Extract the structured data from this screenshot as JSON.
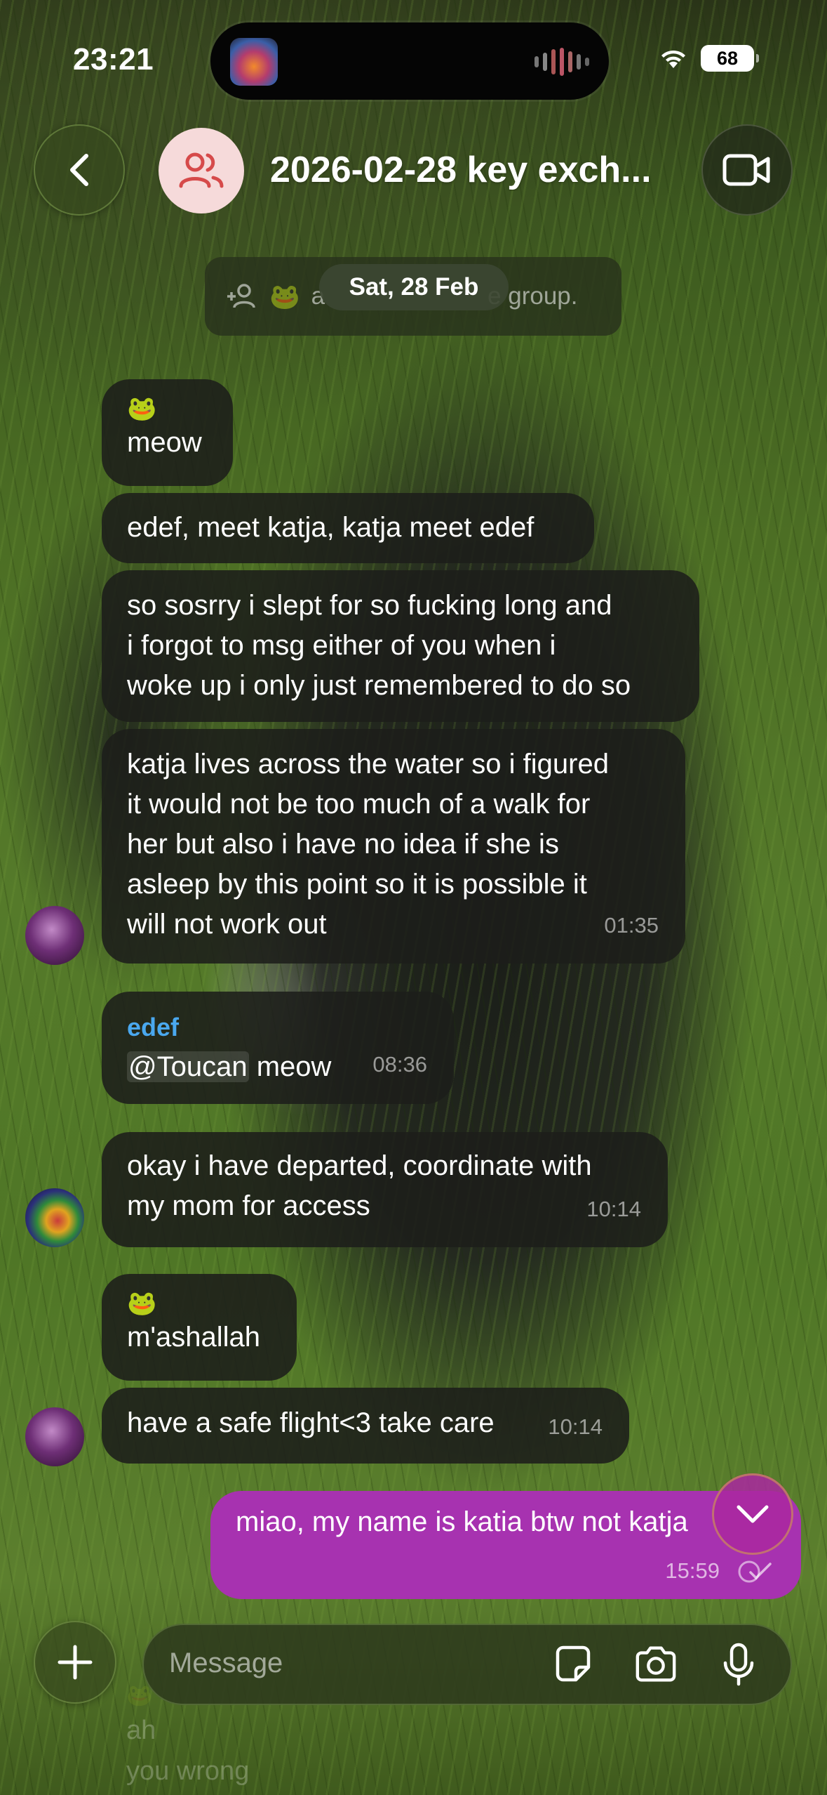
{
  "status_bar": {
    "time": "23:21",
    "battery": "68"
  },
  "header": {
    "title": "2026-02-28 key exch..."
  },
  "system": {
    "added_text_left": "a",
    "added_text_right": "e group.",
    "date": "Sat, 28 Feb",
    "emoji": "🐸"
  },
  "messages": {
    "m1": {
      "emoji": "🐸",
      "text": "meow"
    },
    "m2": {
      "text": "edef, meet katja, katja meet edef"
    },
    "m3": {
      "lines": [
        "so sosrry i slept for so fucking long and",
        "i forgot to msg either of you when i",
        "woke up i only just remembered to do so"
      ]
    },
    "m4": {
      "lines": [
        "katja lives across the water so i figured",
        "it would not be too much of a walk for",
        "her but also i have no idea if she is",
        "asleep by this point so it is possible it",
        "will not work out"
      ],
      "time": "01:35"
    },
    "m5": {
      "sender": "edef",
      "mention": "@Toucan",
      "text": " meow",
      "time": "08:36"
    },
    "m6": {
      "lines": [
        "okay i have departed, coordinate with",
        "my mom for access"
      ],
      "time": "10:14"
    },
    "m7": {
      "emoji": "🐸",
      "text": "m'ashallah"
    },
    "m8": {
      "text": "have a safe flight<3 take care",
      "time": "10:14"
    },
    "own": {
      "text": "miao, my name is katia btw not katja",
      "time": "15:59"
    }
  },
  "composer": {
    "placeholder": "Message",
    "behind_lines": [
      "ah",
      "you wrong"
    ],
    "behind_emoji": "🐸"
  },
  "colors": {
    "own_bubble": "#a732b0",
    "sender_name": "#4aa8ef",
    "group_avatar": "#f6dada"
  },
  "icons": [
    "back-chevron-icon",
    "group-icon",
    "video-camera-icon",
    "add-user-icon",
    "scroll-down-chevron-icon",
    "plus-icon",
    "sticker-icon",
    "camera-icon",
    "microphone-icon",
    "wifi-icon",
    "read-checkmarks-icon"
  ]
}
